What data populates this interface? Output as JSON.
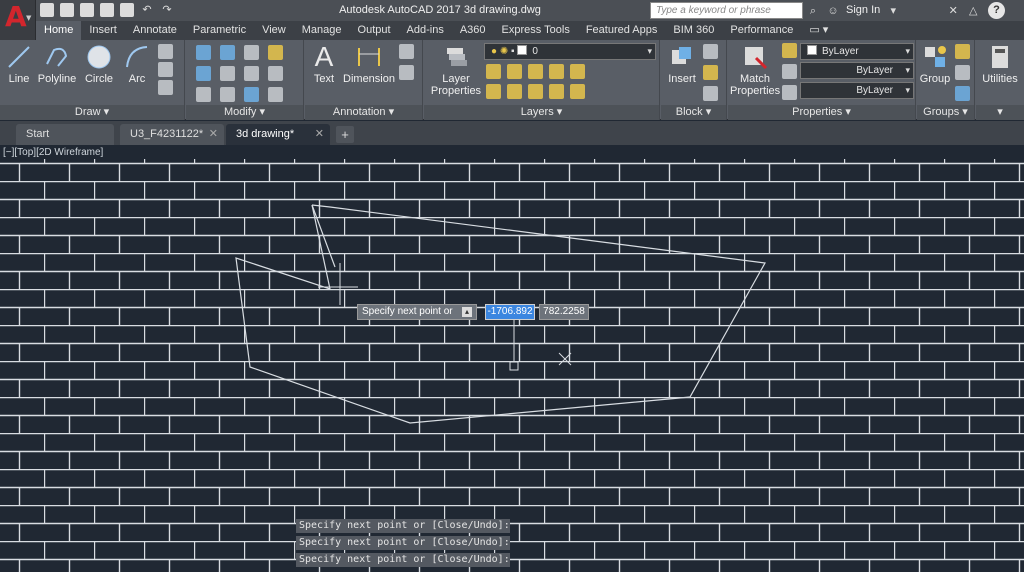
{
  "titlebar": {
    "title": "Autodesk AutoCAD 2017    3d drawing.dwg",
    "search_placeholder": "Type a keyword or phrase",
    "signin_label": "Sign In"
  },
  "ribbon_tabs": [
    "Home",
    "Insert",
    "Annotate",
    "Parametric",
    "View",
    "Manage",
    "Output",
    "Add-ins",
    "A360",
    "Express Tools",
    "Featured Apps",
    "BIM 360",
    "Performance"
  ],
  "draw": {
    "line": "Line",
    "polyline": "Polyline",
    "circle": "Circle",
    "arc": "Arc",
    "footer": "Draw"
  },
  "modify": {
    "footer": "Modify"
  },
  "annotation": {
    "text": "Text",
    "dimension": "Dimension",
    "footer": "Annotation"
  },
  "layers": {
    "layer_properties_l1": "Layer",
    "layer_properties_l2": "Properties",
    "current_layer": "0",
    "footer": "Layers"
  },
  "block": {
    "insert": "Insert",
    "footer": "Block"
  },
  "properties": {
    "match_l1": "Match",
    "match_l2": "Properties",
    "color": "ByLayer",
    "linetype": "ByLayer",
    "lineweight": "ByLayer",
    "footer": "Properties"
  },
  "groups": {
    "group": "Group",
    "footer": "Groups"
  },
  "utilities": {
    "label": "Utilities"
  },
  "file_tabs": [
    "Start",
    "U3_F4231122*",
    "3d drawing*"
  ],
  "viewport": {
    "label": "[−][Top][2D Wireframe]",
    "prompt": "Specify next point or",
    "coord_x": "-1706.892",
    "coord_y": "782.2258"
  },
  "command_history": [
    "Specify next point or [Close/Undo]:",
    "Specify next point or [Close/Undo]:",
    "Specify next point or [Close/Undo]:"
  ],
  "colors": {
    "accent": "#3b86e0",
    "logo": "#d3262d",
    "background": "#202833",
    "hatch": "#d9dde2"
  }
}
